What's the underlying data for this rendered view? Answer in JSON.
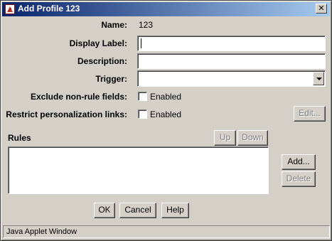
{
  "window": {
    "title": "Add Profile 123",
    "close_glyph": "✕"
  },
  "form": {
    "name_label": "Name:",
    "name_value": "123",
    "display_label_label": "Display Label:",
    "display_label_value": "",
    "description_label": "Description:",
    "description_value": "",
    "trigger_label": "Trigger:",
    "trigger_value": "",
    "exclude_label": "Exclude non-rule fields:",
    "exclude_checkbox_label": "Enabled",
    "exclude_checked": false,
    "restrict_label": "Restrict personalization links:",
    "restrict_checkbox_label": "Enabled",
    "restrict_checked": false,
    "edit_button": "Edit..."
  },
  "rules": {
    "label": "Rules",
    "up_button": "Up",
    "down_button": "Down",
    "add_button": "Add...",
    "delete_button": "Delete",
    "items": []
  },
  "footer": {
    "ok_button": "OK",
    "cancel_button": "Cancel",
    "help_button": "Help"
  },
  "status": {
    "text": "Java Applet Window"
  },
  "icons": {
    "app": "java-applet-icon",
    "close": "close-icon",
    "dropdown": "chevron-down-icon"
  }
}
